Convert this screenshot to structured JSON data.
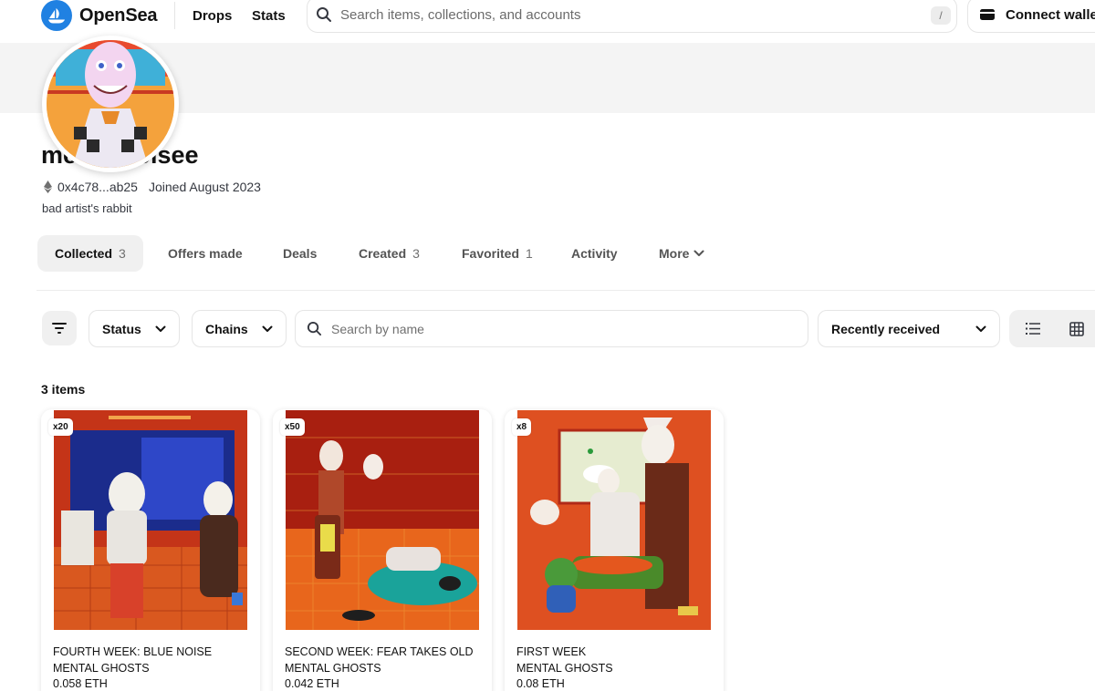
{
  "app": {
    "name": "OpenSea"
  },
  "nav": {
    "links": [
      "Drops",
      "Stats"
    ],
    "search_placeholder": "Search items, collections, and accounts",
    "search_shortcut": "/",
    "connect_wallet": "Connect wallet"
  },
  "profile": {
    "username": "mentalnoisee",
    "address": "0x4c78...ab25",
    "joined": "Joined August 2023",
    "bio": "bad artist's rabbit"
  },
  "tabs": [
    {
      "label": "Collected",
      "count": "3"
    },
    {
      "label": "Offers made",
      "count": ""
    },
    {
      "label": "Deals",
      "count": ""
    },
    {
      "label": "Created",
      "count": "3"
    },
    {
      "label": "Favorited",
      "count": "1"
    },
    {
      "label": "Activity",
      "count": ""
    },
    {
      "label": "More",
      "count": ""
    }
  ],
  "filters": {
    "status": "Status",
    "chains": "Chains",
    "search_placeholder": "Search by name",
    "sort": "Recently received"
  },
  "items_count": "3 items",
  "items": [
    {
      "badge": "x20",
      "title_line1": "FOURTH WEEK: BLUE NOISE",
      "title_line2": "MENTAL GHOSTS",
      "price": "0.058 ETH"
    },
    {
      "badge": "x50",
      "title_line1": "SECOND WEEK: FEAR TAKES OLD",
      "title_line2": "MENTAL GHOSTS",
      "price": "0.042 ETH"
    },
    {
      "badge": "x8",
      "title_line1": "FIRST WEEK",
      "title_line2": "MENTAL GHOSTS",
      "price": "0.08 ETH"
    }
  ],
  "colors": {
    "brand": "#2081e2",
    "text": "#121212",
    "muted": "#707070",
    "chip_bg": "#f0f0f0",
    "banner_bg": "#f4f4f4"
  },
  "icons": [
    "opensea-logo-icon",
    "search-icon",
    "wallet-icon",
    "ethereum-icon",
    "chevron-down-icon",
    "filter-icon",
    "list-view-icon",
    "grid-view-icon"
  ]
}
